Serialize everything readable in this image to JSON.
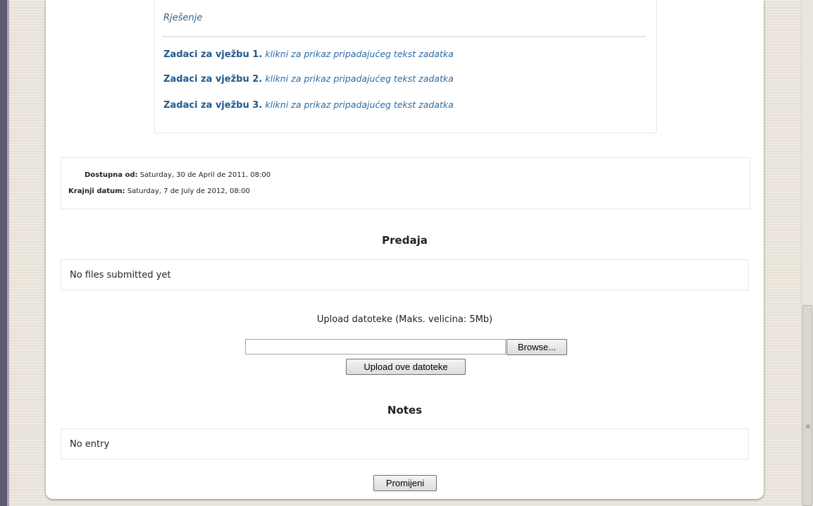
{
  "content": {
    "solution_link": "Rješenje",
    "tasks": [
      {
        "title": "Zadaci za vježbu 1.",
        "link": "klikni za prikaz pripadajućeg tekst zadatka"
      },
      {
        "title": "Zadaci za vježbu 2.",
        "link": "klikni za prikaz pripadajućeg tekst zadatka"
      },
      {
        "title": "Zadaci za vježbu 3.",
        "link": "klikni za prikaz pripadajućeg tekst zadatka"
      }
    ]
  },
  "dates": {
    "available_label": "Dostupna od:",
    "available_value": "Saturday, 30 de April de 2011, 08:00",
    "due_label": "Krajnji datum:",
    "due_value": "Saturday, 7 de July de 2012, 08:00"
  },
  "submission": {
    "heading": "Predaja",
    "status": "No files submitted yet",
    "upload_label": "Upload datoteke (Maks. velicina: 5Mb)",
    "file_value": "",
    "browse_label": "Browse...",
    "upload_button": "Upload ove datoteke"
  },
  "notes": {
    "heading": "Notes",
    "entry": "No entry",
    "edit_button": "Promijeni"
  },
  "scrollbar": {
    "grip_icon": "grip-lines-icon"
  }
}
